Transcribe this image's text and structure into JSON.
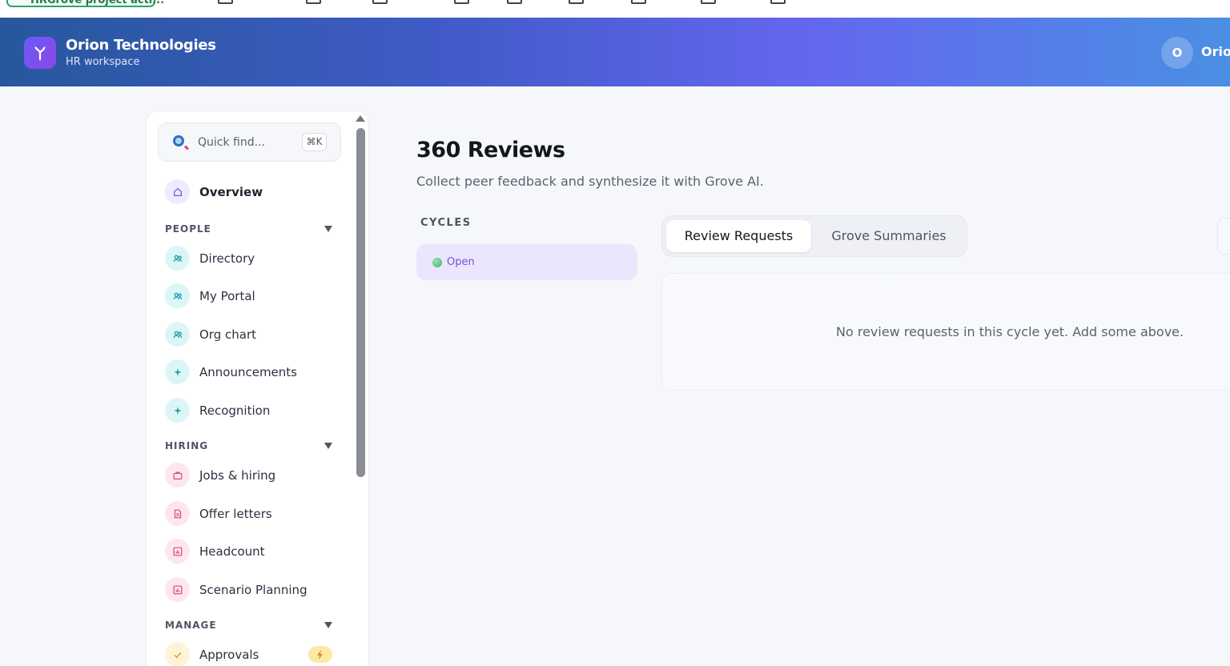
{
  "browser": {
    "active_bookmark": "HRGrove project acti..."
  },
  "header": {
    "company": "Orion Technologies",
    "workspace": "HR workspace",
    "avatar_initial": "O",
    "user_name": "Orion"
  },
  "sidebar": {
    "search_placeholder": "Quick find...",
    "search_shortcut": "⌘K",
    "overview": "Overview",
    "sections": [
      {
        "label": "PEOPLE",
        "items": [
          "Directory",
          "My Portal",
          "Org chart",
          "Announcements",
          "Recognition"
        ]
      },
      {
        "label": "HIRING",
        "items": [
          "Jobs & hiring",
          "Offer letters",
          "Headcount",
          "Scenario Planning"
        ]
      },
      {
        "label": "MANAGE",
        "items": [
          "Approvals"
        ]
      }
    ]
  },
  "main": {
    "title": "360 Reviews",
    "subtitle": "Collect peer feedback and synthesize it with Grove AI.",
    "cycles_label": "CYCLES",
    "cycle_status": "Open",
    "tabs": [
      "Review Requests",
      "Grove Summaries"
    ],
    "empty_message": "No review requests in this cycle yet. Add some above."
  },
  "colors": {
    "accent": "#6566ee",
    "header_start": "#27579c",
    "header_end": "#4a8fe4",
    "cycle_pill": "#ebe6fd",
    "status_open": "#3fae6d"
  }
}
